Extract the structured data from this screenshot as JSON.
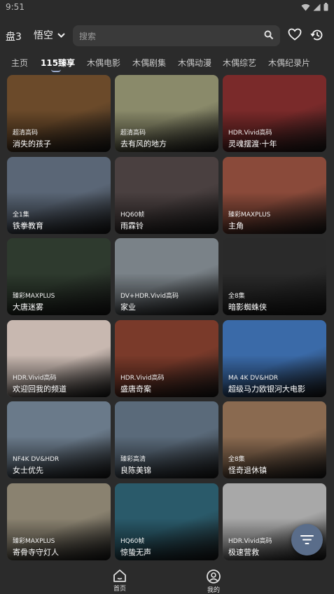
{
  "status_bar": {
    "time": "9:51"
  },
  "top_bar": {
    "disk_label": "盘3",
    "source_label": "悟空",
    "search_placeholder": "搜索"
  },
  "tabs": [
    {
      "label": "主页",
      "active": false
    },
    {
      "label": "115臻享",
      "active": true
    },
    {
      "label": "木偶电影",
      "active": false
    },
    {
      "label": "木偶剧集",
      "active": false
    },
    {
      "label": "木偶动漫",
      "active": false
    },
    {
      "label": "木偶综艺",
      "active": false
    },
    {
      "label": "木偶纪录片",
      "active": false
    }
  ],
  "cards": [
    {
      "badge": "超清高码",
      "title": "消失的孩子",
      "color": "#6b4a2a"
    },
    {
      "badge": "超清高码",
      "title": "去有风的地方",
      "color": "#8a8a6a"
    },
    {
      "badge": "HDR.Vivid高码",
      "title": "灵魂摆渡·十年",
      "color": "#7a2a2a"
    },
    {
      "badge": "全1集",
      "title": "铁拳教育",
      "color": "#5a6676"
    },
    {
      "badge": "HQ60帧",
      "title": "雨霖铃",
      "color": "#4a4040"
    },
    {
      "badge": "臻彩MAXPLUS",
      "title": "主角",
      "color": "#8a4a3a"
    },
    {
      "badge": "臻彩MAXPLUS",
      "title": "大唐迷雾",
      "color": "#2e3a2e"
    },
    {
      "badge": "DV+HDR.Vivid高码",
      "title": "家业",
      "color": "#7a8288"
    },
    {
      "badge": "全8集",
      "title": "暗影蜘蛛侠",
      "color": "#2a2a2a"
    },
    {
      "badge": "HDR.Vivid高码",
      "title": "欢迎回我的频道",
      "color": "#c8b8b0"
    },
    {
      "badge": "HDR.Vivid高码",
      "title": "盛唐奇案",
      "color": "#7a3a2a"
    },
    {
      "badge": "MA 4K DV&HDR",
      "title": "超级马力欧银河大电影",
      "color": "#3a6aa8"
    },
    {
      "badge": "NF4K DV&HDR",
      "title": "女士优先",
      "color": "#6a7a8a"
    },
    {
      "badge": "臻彩高清",
      "title": "良陈美锦",
      "color": "#5a6a7a"
    },
    {
      "badge": "全8集",
      "title": "怪奇退休镇",
      "color": "#8a6a50"
    },
    {
      "badge": "臻彩MAXPLUS",
      "title": "寄骨寺守灯人",
      "color": "#8a8270"
    },
    {
      "badge": "HQ60帧",
      "title": "惊蛰无声",
      "color": "#2a5a6a"
    },
    {
      "badge": "HDR.Vivid高码",
      "title": "极速营救",
      "color": "#a8a8a8"
    }
  ],
  "bottom_nav": [
    {
      "label": "首页",
      "icon": "home-icon"
    },
    {
      "label": "我的",
      "icon": "profile-icon"
    }
  ],
  "icons": [
    "search-icon",
    "heart-icon",
    "history-icon",
    "chevron-down-icon",
    "filter-icon",
    "home-icon",
    "profile-icon",
    "wifi-icon",
    "signal-icon",
    "battery-icon"
  ]
}
